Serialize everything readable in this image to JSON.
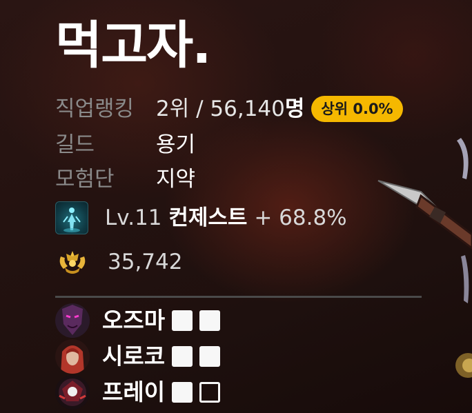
{
  "character": {
    "name": "먹고자."
  },
  "ranking": {
    "label": "직업랭킹",
    "rank": "2위",
    "total": " / 56,140",
    "unit": "명",
    "badge": "상위 0.0%",
    "badge_color": "#f5b800"
  },
  "guild": {
    "label": "길드",
    "value": "용기"
  },
  "expedition": {
    "label": "모험단",
    "value": "지약"
  },
  "level": {
    "icon": "adventurer-figure-icon",
    "prefix": "Lv.11",
    "title": "컨제스트",
    "suffix": "+ 68.8%"
  },
  "power": {
    "icon": "gold-laurel-crest-icon",
    "value": "35,742"
  },
  "party": [
    {
      "name": "오즈마",
      "avatar": "ozma-portrait-icon",
      "slots": [
        "filled",
        "filled"
      ]
    },
    {
      "name": "시로코",
      "avatar": "siroco-portrait-icon",
      "slots": [
        "filled",
        "filled"
      ]
    },
    {
      "name": "프레이",
      "avatar": "prey-portrait-icon",
      "slots": [
        "filled",
        "empty"
      ]
    }
  ]
}
